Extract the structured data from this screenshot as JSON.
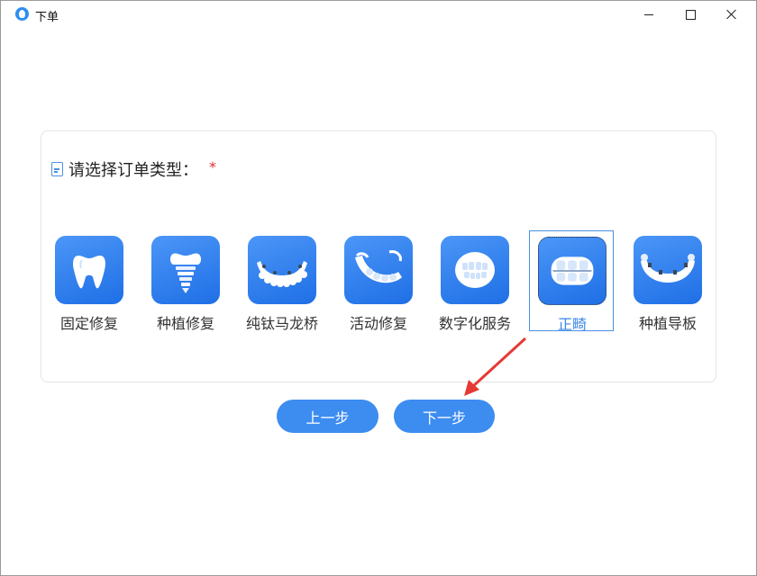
{
  "window": {
    "title": "下单",
    "controls": [
      "minimize",
      "maximize",
      "close"
    ]
  },
  "prompt": {
    "text": "请选择订单类型：",
    "required_mark": "*"
  },
  "order_types": [
    {
      "label": "固定修复",
      "icon": "tooth-icon",
      "selected": false
    },
    {
      "label": "种植修复",
      "icon": "implant-icon",
      "selected": false
    },
    {
      "label": "纯钛马龙桥",
      "icon": "titanium-bridge-icon",
      "selected": false
    },
    {
      "label": "活动修复",
      "icon": "removable-denture-icon",
      "selected": false
    },
    {
      "label": "数字化服务",
      "icon": "smile-teeth-icon",
      "selected": false
    },
    {
      "label": "正畸",
      "icon": "braces-icon",
      "selected": true
    },
    {
      "label": "种植导板",
      "icon": "implant-guide-icon",
      "selected": false
    }
  ],
  "buttons": {
    "prev_label": "上一步",
    "next_label": "下一步"
  },
  "colors": {
    "accent": "#3d8cf0",
    "selected_text": "#3a86e8",
    "required": "#e02b2b",
    "annotation_arrow": "#e53935"
  }
}
